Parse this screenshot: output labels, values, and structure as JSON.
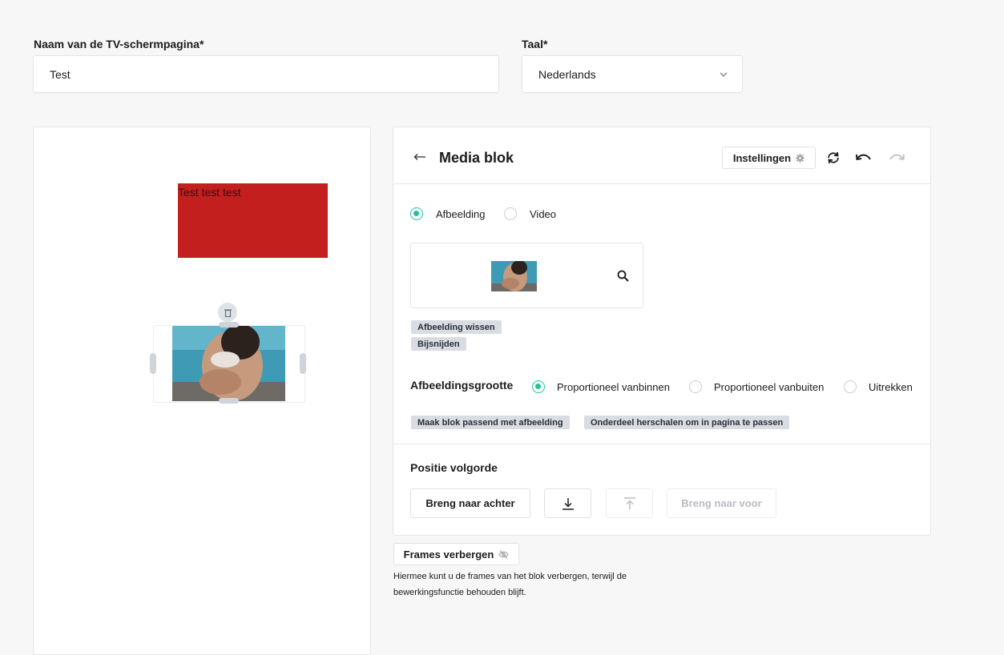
{
  "form": {
    "name_label": "Naam van de TV-schermpagina*",
    "name_value": "Test",
    "language_label": "Taal*",
    "language_value": "Nederlands"
  },
  "canvas": {
    "text_block": "Test test test",
    "text_block_color": "#c41f1f"
  },
  "editor": {
    "title": "Media blok",
    "settings_label": "Instellingen",
    "media_types": [
      "Afbeelding",
      "Video"
    ],
    "media_selected": "Afbeelding",
    "clear_image": "Afbeelding wissen",
    "crop": "Bijsnijden",
    "size_label": "Afbeeldingsgrootte",
    "size_options": [
      "Proportioneel vanbinnen",
      "Proportioneel vanbuiten",
      "Uitrekken"
    ],
    "size_selected": "Proportioneel vanbinnen",
    "fit_block": "Maak blok passend met afbeelding",
    "rescale": "Onderdeel herschalen om in pagina te passen",
    "position_label": "Positie volgorde",
    "send_back": "Breng naar achter",
    "bring_front": "Breng naar voor",
    "accent": "#20c3a0"
  },
  "frames": {
    "button_label": "Frames verbergen",
    "help_line1": "Hiermee kunt u de frames van het blok verbergen, terwijl de",
    "help_line2": "bewerkingsfunctie behouden blijft."
  }
}
